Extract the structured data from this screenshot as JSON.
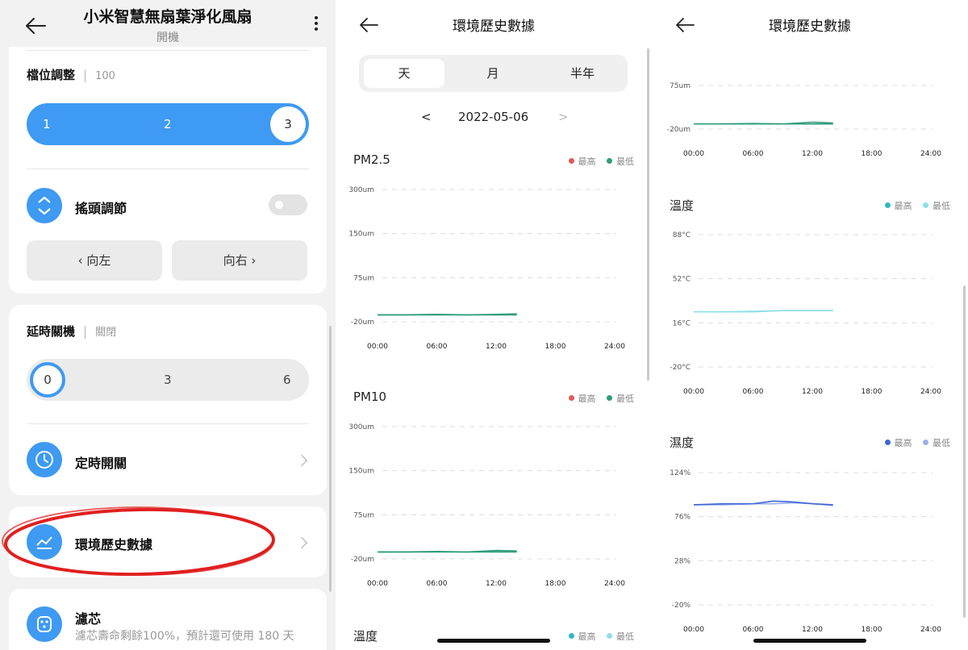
{
  "device": {
    "title": "小米智慧無扇葉淨化風扇",
    "status": "開機",
    "speed": {
      "label": "檔位調整",
      "value": "100",
      "options": [
        "1",
        "2",
        "3"
      ],
      "selected": "3"
    },
    "oscillation": {
      "label": "搖頭調節",
      "enabled": false,
      "left_label": "向左",
      "right_label": "向右"
    },
    "delay_off": {
      "label": "延時關機",
      "value": "關閉",
      "options": [
        "0",
        "3",
        "6"
      ],
      "selected": "0"
    },
    "timer": {
      "label": "定時開關"
    },
    "history": {
      "label": "環境歷史數據"
    },
    "filter": {
      "label": "濾芯",
      "desc": "濾芯壽命剩餘100%，預計還可使用 180 天"
    },
    "accent_color": "#3e9af2",
    "highlight_color": "#e02020"
  },
  "history_page": {
    "title": "環境歷史數據",
    "tabs": [
      "天",
      "月",
      "半年"
    ],
    "active_tab": "天",
    "date": "2022-05-06",
    "prev_symbol": "<",
    "next_symbol": ">",
    "legend_max": "最高",
    "legend_min": "最低"
  },
  "chart_data": [
    {
      "id": "pm25",
      "type": "line",
      "title": "PM2.5",
      "y_ticks": [
        "300um",
        "150um",
        "75um",
        "-20um"
      ],
      "y_values": [
        300,
        150,
        75,
        -20
      ],
      "x_ticks": [
        "00:00",
        "06:00",
        "12:00",
        "18:00",
        "24:00"
      ],
      "colors": {
        "max": "#e05a5a",
        "min": "#2e9c7c"
      },
      "series": [
        {
          "name": "最高",
          "x": [
            0,
            3,
            6,
            9,
            12,
            14
          ],
          "y": [
            -5,
            -5,
            -4,
            -5,
            -4,
            -3
          ]
        },
        {
          "name": "最低",
          "x": [
            0,
            3,
            6,
            9,
            12,
            14
          ],
          "y": [
            -5,
            -5,
            -5,
            -5,
            -5,
            -5
          ]
        }
      ]
    },
    {
      "id": "pm10",
      "type": "line",
      "title": "PM10",
      "y_ticks": [
        "300um",
        "150um",
        "75um",
        "-20um"
      ],
      "y_values": [
        300,
        150,
        75,
        -20
      ],
      "x_ticks": [
        "00:00",
        "06:00",
        "12:00",
        "18:00",
        "24:00"
      ],
      "colors": {
        "max": "#e05a5a",
        "min": "#2e9c7c"
      },
      "series": [
        {
          "name": "最高",
          "x": [
            0,
            3,
            6,
            9,
            12,
            14
          ],
          "y": [
            -5,
            -5,
            -4,
            -5,
            -2,
            -3
          ]
        },
        {
          "name": "最低",
          "x": [
            0,
            3,
            6,
            9,
            12,
            14
          ],
          "y": [
            -5,
            -5,
            -5,
            -5,
            -5,
            -5
          ]
        }
      ]
    },
    {
      "id": "partial_top",
      "type": "line",
      "title": "",
      "y_ticks": [
        "75um",
        "-20um"
      ],
      "y_values": [
        75,
        -20
      ],
      "x_ticks": [
        "00:00",
        "06:00",
        "12:00",
        "18:00",
        "24:00"
      ],
      "colors": {
        "max": "#e05a5a",
        "min": "#2e9c7c"
      },
      "series": [
        {
          "name": "最高",
          "x": [
            0,
            3,
            6,
            9,
            12,
            14
          ],
          "y": [
            -9,
            -9,
            -8,
            -9,
            -5,
            -7
          ]
        },
        {
          "name": "最低",
          "x": [
            0,
            3,
            6,
            9,
            12,
            14
          ],
          "y": [
            -9,
            -9,
            -9,
            -9,
            -9,
            -9
          ]
        }
      ]
    },
    {
      "id": "temperature",
      "type": "line",
      "title": "溫度",
      "y_ticks": [
        "88°C",
        "52°C",
        "16°C",
        "-20°C"
      ],
      "y_values": [
        88,
        52,
        16,
        -20
      ],
      "x_ticks": [
        "00:00",
        "06:00",
        "12:00",
        "18:00",
        "24:00"
      ],
      "colors": {
        "max": "#2fb8c8",
        "min": "#8fe0e8"
      },
      "series": [
        {
          "name": "最高",
          "x": [
            0,
            3,
            6,
            9,
            12,
            14
          ],
          "y": [
            25,
            25,
            25.5,
            26,
            26,
            26
          ]
        },
        {
          "name": "最低",
          "x": [
            0,
            3,
            6,
            9,
            12,
            14
          ],
          "y": [
            25,
            25,
            25,
            26,
            26,
            26
          ]
        }
      ]
    },
    {
      "id": "humidity",
      "type": "line",
      "title": "濕度",
      "y_ticks": [
        "124%",
        "76%",
        "28%",
        "-20%"
      ],
      "y_values": [
        124,
        76,
        28,
        -20
      ],
      "x_ticks": [
        "00:00",
        "06:00",
        "12:00",
        "18:00",
        "24:00"
      ],
      "colors": {
        "max": "#3f66d4",
        "min": "#9bb0ea"
      },
      "series": [
        {
          "name": "最高",
          "x": [
            0,
            3,
            6,
            8,
            10,
            12,
            14
          ],
          "y": [
            89,
            90,
            90,
            93,
            92,
            90,
            89
          ]
        },
        {
          "name": "最低",
          "x": [
            0,
            3,
            6,
            8,
            10,
            12,
            14
          ],
          "y": [
            89,
            89,
            90,
            90,
            91,
            90,
            88
          ]
        }
      ]
    },
    {
      "id": "temperature_next",
      "type": "line",
      "title": "溫度",
      "colors": {
        "max": "#2fb8c8",
        "min": "#8fe0e8"
      },
      "series": []
    }
  ]
}
